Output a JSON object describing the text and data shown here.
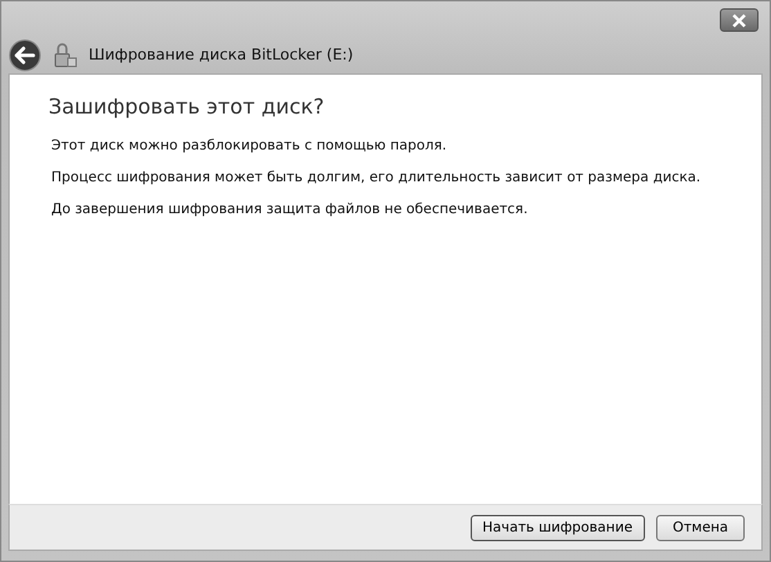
{
  "window": {
    "title": "Шифрование диска BitLocker (E:)"
  },
  "heading": "Зашифровать этот диск?",
  "paragraphs": [
    "Этот диск можно разблокировать с помощью пароля.",
    "Процесс шифрования может быть долгим, его длительность зависит от размера диска.",
    "До завершения шифрования защита файлов не обеспечивается."
  ],
  "buttons": [
    {
      "label": "Начать шифрование",
      "kind": "primary"
    },
    {
      "label": "Отмена",
      "kind": "cancel"
    }
  ]
}
